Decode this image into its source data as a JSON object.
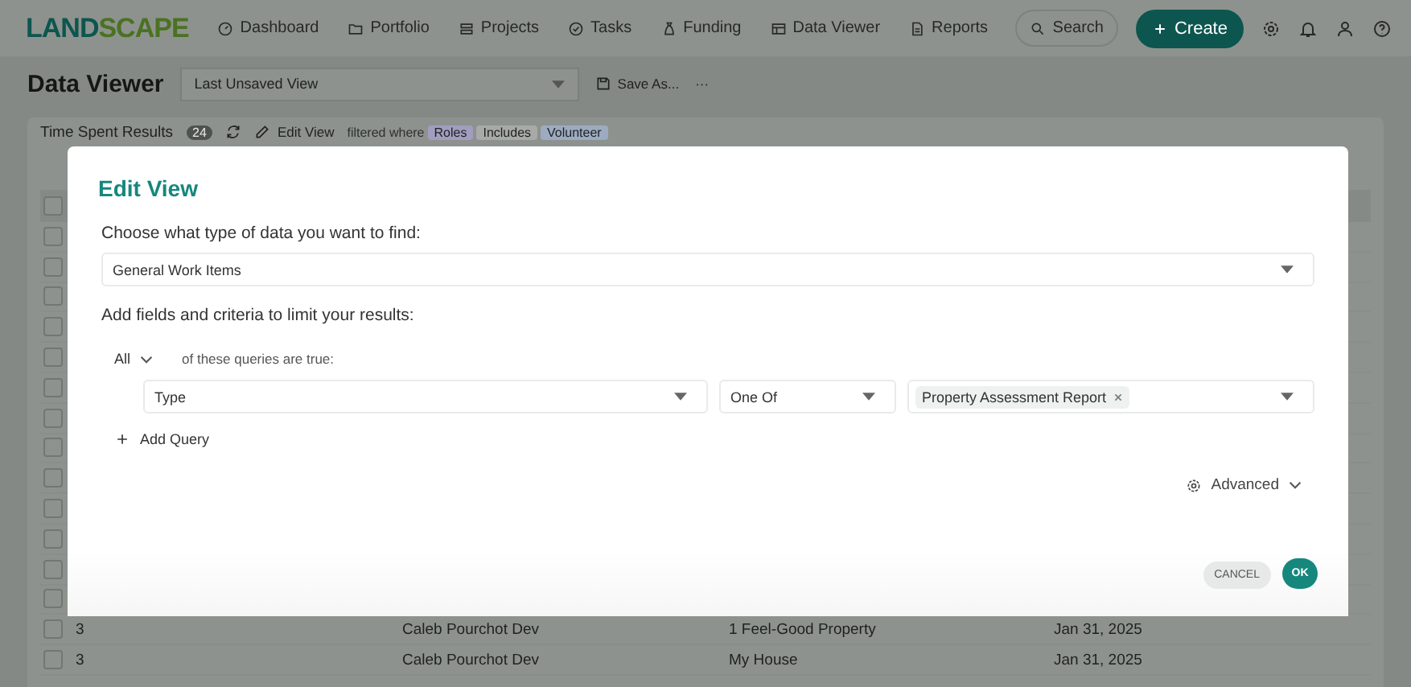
{
  "nav": {
    "logo": [
      "LAND",
      "SCAPE"
    ],
    "items": [
      {
        "label": "Dashboard"
      },
      {
        "label": "Portfolio"
      },
      {
        "label": "Projects"
      },
      {
        "label": "Tasks"
      },
      {
        "label": "Funding"
      },
      {
        "label": "Data Viewer"
      },
      {
        "label": "Reports"
      }
    ],
    "search": "Search",
    "create": "Create"
  },
  "page": {
    "title": "Data Viewer",
    "view_select": "Last Unsaved View",
    "save_as": "Save As...",
    "more": "···"
  },
  "results": {
    "title": "Time Spent Results",
    "count": "24",
    "edit_view": "Edit View",
    "filtered_where": "filtered where",
    "tags": [
      {
        "label": "Roles",
        "color": "#a19dc0"
      },
      {
        "label": "Includes",
        "color": "#a8aaa8"
      },
      {
        "label": "Volunteer",
        "color": "#9dabc2"
      }
    ]
  },
  "table": {
    "header_checked": false,
    "rows": [
      {
        "checked": false
      },
      {
        "checked": false
      },
      {
        "checked": false
      },
      {
        "checked": false
      },
      {
        "checked": false
      },
      {
        "checked": false
      },
      {
        "checked": false
      },
      {
        "checked": false
      },
      {
        "checked": false
      },
      {
        "checked": false
      },
      {
        "checked": false
      },
      {
        "checked": false
      },
      {
        "checked": false
      },
      {
        "checked": false,
        "cells": [
          "3",
          "Caleb Pourchot Dev",
          "1 Feel-Good Property",
          "Jan 31, 2025"
        ]
      },
      {
        "checked": false,
        "cells": [
          "3",
          "Caleb Pourchot Dev",
          "My House",
          "Jan 31, 2025"
        ]
      }
    ]
  },
  "dialog": {
    "title": "Edit View",
    "type_label": "Choose what type of data you want to find:",
    "type_value": "General Work Items",
    "criteria_label": "Add fields and criteria to limit your results:",
    "match": "All",
    "match_text": "of these queries are true:",
    "queries": [
      {
        "field": "Type",
        "operator": "One Of",
        "values": [
          "Property Assessment Report"
        ]
      }
    ],
    "add_query": "Add Query",
    "advanced": "Advanced",
    "cancel": "CANCEL",
    "ok": "OK"
  }
}
